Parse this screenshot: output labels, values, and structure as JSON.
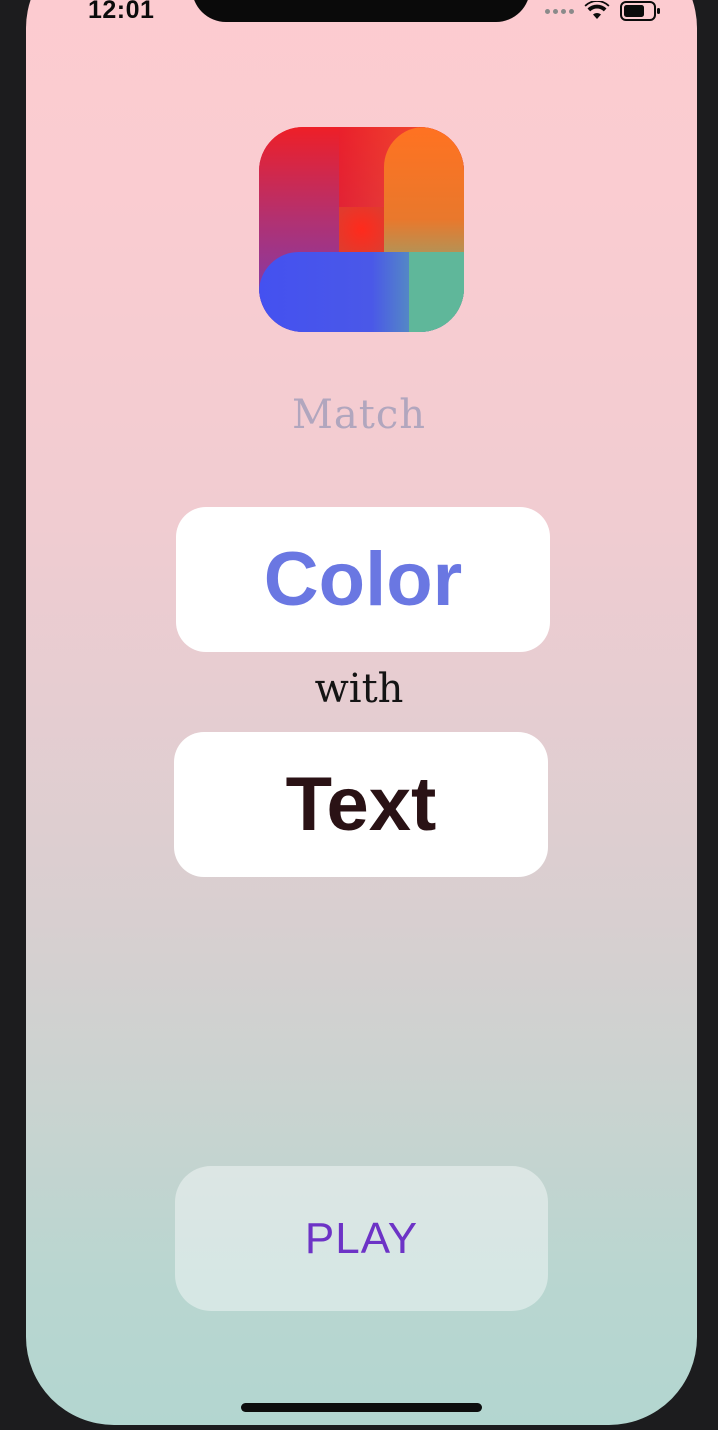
{
  "status_bar": {
    "time": "12:01",
    "icons": [
      "cellular-signal-icon",
      "wifi-icon",
      "battery-icon"
    ]
  },
  "app": {
    "icon": "match-app-logo-icon",
    "title": "Match"
  },
  "cards": {
    "color_label": "Color",
    "connector": "with",
    "text_label": "Text"
  },
  "actions": {
    "play_label": "PLAY"
  },
  "colors": {
    "color_word": "#6a77e2",
    "text_word": "#2a1215",
    "play_text": "#6d33c6",
    "title_text": "#b1a6be",
    "background_top": "#fdcbd0",
    "background_bottom": "#b3d6d0"
  }
}
